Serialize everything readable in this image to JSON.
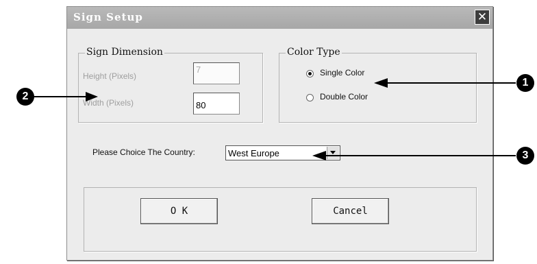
{
  "dialog": {
    "title": "Sign Setup",
    "close_icon": "close-icon"
  },
  "sign_dimension": {
    "legend": "Sign Dimension",
    "height_label": "Height (Pixels)",
    "height_value": "7",
    "width_label": "Width (Pixels)",
    "width_value": "80"
  },
  "color_type": {
    "legend": "Color Type",
    "options": [
      {
        "label": "Single Color",
        "selected": true
      },
      {
        "label": "Double Color",
        "selected": false
      }
    ]
  },
  "country": {
    "label": "Please Choice The Country:",
    "selected": "West Europe"
  },
  "buttons": {
    "ok": "O K",
    "cancel": "Cancel"
  },
  "callouts": [
    "1",
    "2",
    "3"
  ]
}
